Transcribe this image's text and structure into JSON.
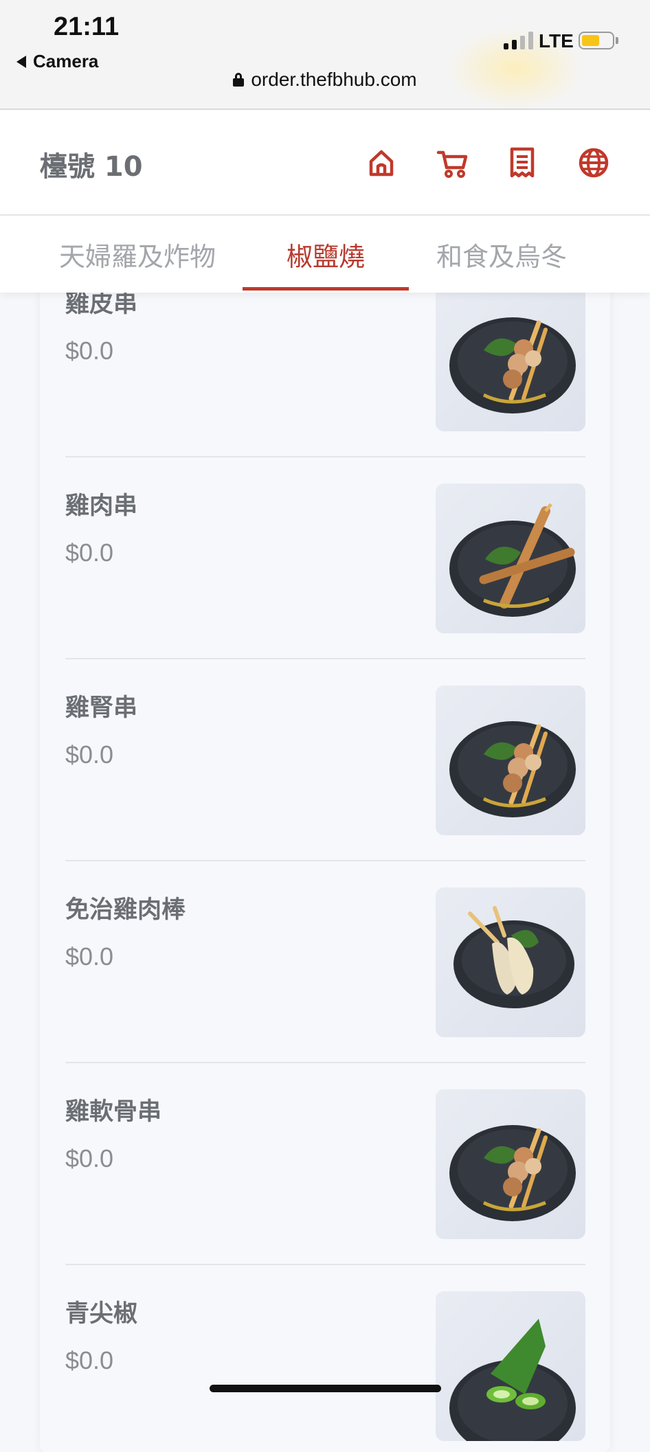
{
  "status_bar": {
    "time": "21:11",
    "back_app": "Camera",
    "network": "LTE",
    "url": "order.thefbhub.com"
  },
  "header": {
    "table_label": "檯號 10",
    "icons": [
      "home-icon",
      "cart-icon",
      "receipt-icon",
      "globe-icon"
    ]
  },
  "tabs": [
    {
      "label": "天婦羅及炸物",
      "active": false
    },
    {
      "label": "椒鹽燒",
      "active": true
    },
    {
      "label": "和食及烏冬",
      "active": false
    }
  ],
  "items": [
    {
      "name": "雞皮串",
      "price": "$0.0",
      "image": "chicken-skewer"
    },
    {
      "name": "雞肉串",
      "price": "$0.0",
      "image": "chicken-meat-skewer"
    },
    {
      "name": "雞腎串",
      "price": "$0.0",
      "image": "chicken-skewer"
    },
    {
      "name": "免治雞肉棒",
      "price": "$0.0",
      "image": "minced-chicken-stick"
    },
    {
      "name": "雞軟骨串",
      "price": "$0.0",
      "image": "chicken-skewer"
    },
    {
      "name": "青尖椒",
      "price": "$0.0",
      "image": "green-pepper"
    }
  ],
  "colors": {
    "accent": "#c0392b",
    "text": "#6b6f73",
    "muted": "#a3a6ab",
    "background": "#f5f7fb"
  }
}
